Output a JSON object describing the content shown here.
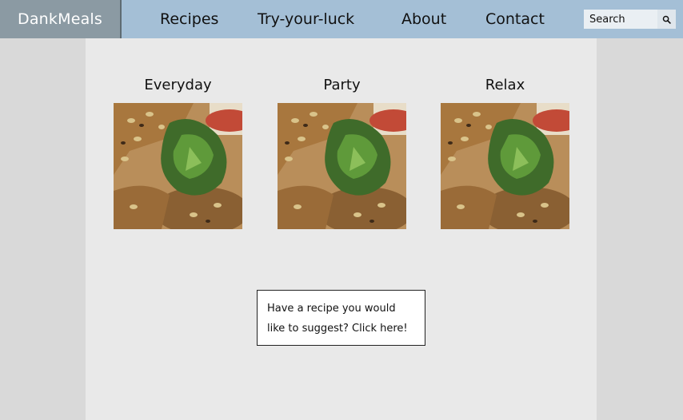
{
  "header": {
    "brand": "DankMeals",
    "nav": [
      "Recipes",
      "Try-your-luck",
      "About",
      "Contact"
    ],
    "search": {
      "placeholder": "Search",
      "icon": "search-icon"
    }
  },
  "categories": [
    {
      "title": "Everyday",
      "image": "sandwich-photo"
    },
    {
      "title": "Party",
      "image": "sandwich-photo"
    },
    {
      "title": "Relax",
      "image": "sandwich-photo"
    }
  ],
  "suggest": {
    "text": "Have a recipe you would like to suggest? Click here!"
  },
  "colors": {
    "topbar": "#a4bfd6",
    "brand_bg": "#8b9aa3",
    "page_bg": "#d9d9d9",
    "content_bg": "#e9e9e9"
  }
}
